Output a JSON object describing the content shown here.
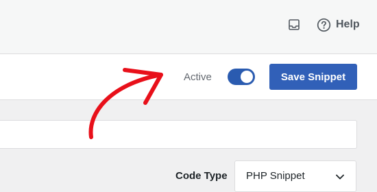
{
  "header": {
    "inbox_icon": "inbox-icon",
    "help_icon": "help-circle-icon",
    "help_label": "Help"
  },
  "toolbar": {
    "active_label": "Active",
    "active_state": true,
    "save_label": "Save Snippet",
    "accent_color": "#3160b8"
  },
  "editor": {
    "title_value": "",
    "code_type_label": "Code Type",
    "code_type_value": "PHP Snippet"
  },
  "annotation": {
    "arrow_color": "#e8101a"
  }
}
